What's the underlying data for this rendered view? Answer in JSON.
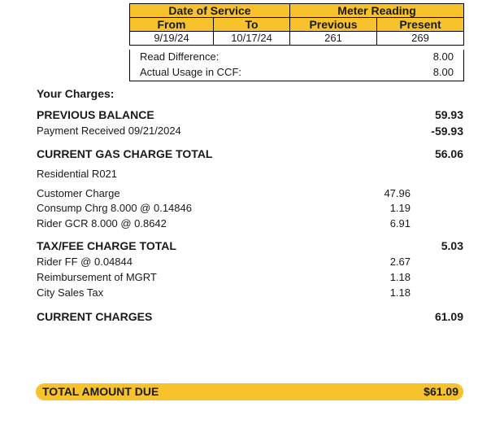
{
  "meter": {
    "date_of_service": "Date of Service",
    "meter_reading": "Meter Reading",
    "from": "From",
    "to": "To",
    "previous": "Previous",
    "present": "Present",
    "from_date": "9/19/24",
    "to_date": "10/17/24",
    "previous_reading": "261",
    "present_reading": "269"
  },
  "usage": {
    "read_difference_label": "Read Difference:",
    "read_difference_value": "8.00",
    "actual_usage_label": "Actual Usage in CCF:",
    "actual_usage_value": "8.00"
  },
  "charges": {
    "heading": "Your Charges:",
    "previous_balance_label": "PREVIOUS BALANCE",
    "previous_balance_value": "59.93",
    "payment_label": "Payment Received  09/21/2024",
    "payment_value": "-59.93",
    "gas_total_label": "CURRENT GAS CHARGE TOTAL",
    "gas_total_value": "56.06",
    "rate_label": "Residential R021",
    "gas_items": [
      {
        "label": "Customer Charge",
        "value": "47.96"
      },
      {
        "label": "Consump Chrg 8.000  @ 0.14846",
        "value": "1.19"
      },
      {
        "label": "Rider GCR 8.000  @ 0.8642",
        "value": "6.91"
      }
    ],
    "tax_total_label": "TAX/FEE CHARGE TOTAL",
    "tax_total_value": "5.03",
    "tax_items": [
      {
        "label": "Rider FF  @ 0.04844",
        "value": "2.67"
      },
      {
        "label": "Reimbursement of MGRT",
        "value": "1.18"
      },
      {
        "label": "City Sales Tax",
        "value": "1.18"
      }
    ],
    "current_charges_label": "CURRENT CHARGES",
    "current_charges_value": "61.09"
  },
  "total": {
    "label": "TOTAL AMOUNT DUE",
    "value": "$61.09"
  },
  "colors": {
    "accent": "#f7c22b"
  }
}
